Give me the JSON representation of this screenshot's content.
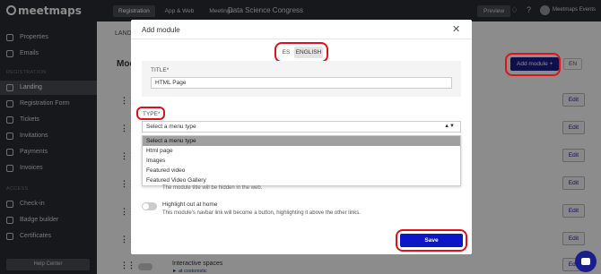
{
  "topbar": {
    "logo_text": "meetmaps",
    "tabs": [
      {
        "label": "Registration",
        "active": true
      },
      {
        "label": "App & Web",
        "active": false
      },
      {
        "label": "Meetings",
        "active": false
      }
    ],
    "event_name": "Data Science Congress",
    "preview_label": "Preview",
    "user_name": "Meetmaps Events"
  },
  "sidebar": {
    "items": [
      {
        "label": "Properties"
      },
      {
        "label": "Emails"
      }
    ],
    "section_registration": "REGISTRATION",
    "reg_items": [
      {
        "label": "Landing",
        "active": true
      },
      {
        "label": "Registration Form"
      },
      {
        "label": "Tickets"
      },
      {
        "label": "Invitations"
      },
      {
        "label": "Payments"
      },
      {
        "label": "Invoices"
      }
    ],
    "section_access": "ACCESS",
    "access_items": [
      {
        "label": "Check-in"
      },
      {
        "label": "Badge builder"
      },
      {
        "label": "Certificates"
      }
    ],
    "help_label": "Help Center"
  },
  "main": {
    "tab_landing": "LANDI",
    "title": "Mod",
    "add_module_label": "Add module +",
    "lang_label": "EN",
    "edit_label": "Edit",
    "interactive_label": "Interactive spaces",
    "interactive_sub": "► at costonistic"
  },
  "modal": {
    "title": "Add module",
    "close": "✕",
    "lang_es": "ES",
    "lang_en": "ENGLISH",
    "title_label": "TITLE*",
    "title_value": "HTML Page",
    "type_label": "TYPE*",
    "type_placeholder": "Select a menu type",
    "type_options": [
      "Select a menu type",
      "Html page",
      "Images",
      "Featured video",
      "Featured Video Gallery"
    ],
    "hidden_note": "The module title will be hidden in the web.",
    "highlight_title": "Highlight out at home",
    "highlight_desc": "This module's navbar link will become a button, highlighting it above the other links.",
    "save_label": "Save"
  },
  "colors": {
    "accent": "#0c17c9",
    "highlight": "#e0111b",
    "dark": "#2b2d33"
  }
}
